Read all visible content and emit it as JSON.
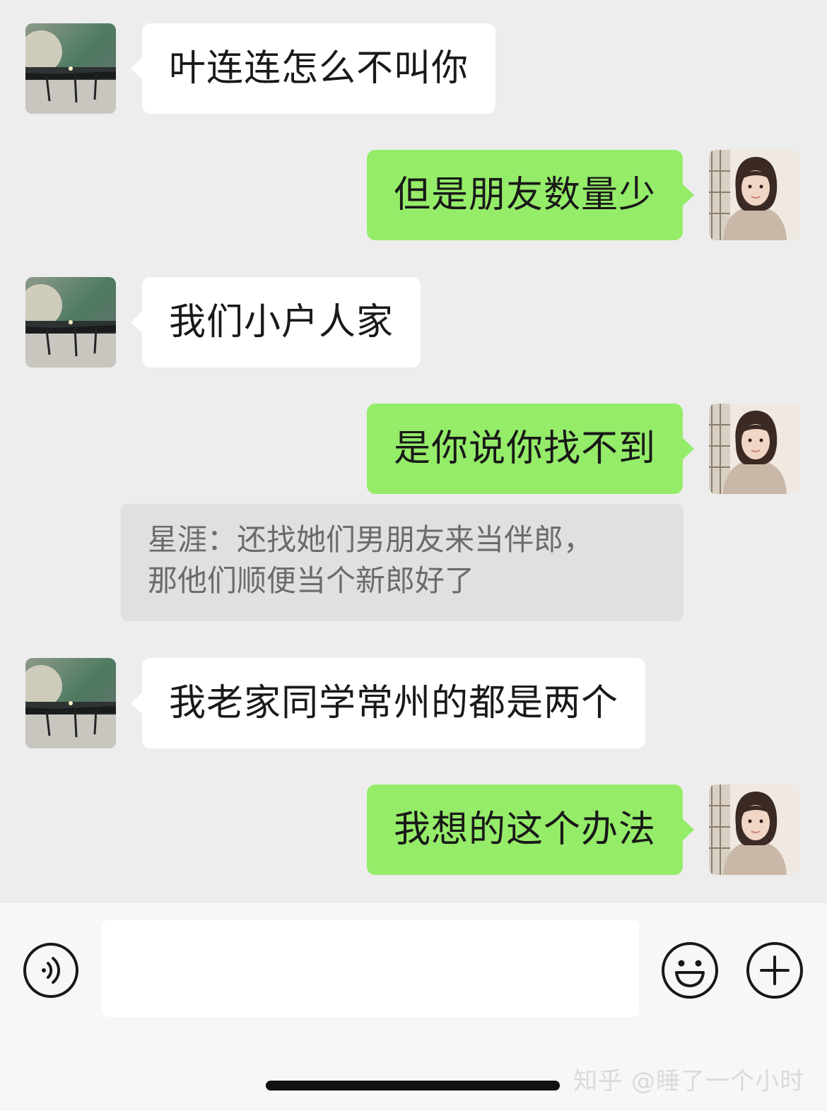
{
  "messages": [
    {
      "side": "left",
      "text": "叶连连怎么不叫你"
    },
    {
      "side": "right",
      "text": "但是朋友数量少"
    },
    {
      "side": "left",
      "text": "我们小户人家"
    },
    {
      "side": "right",
      "text": "是你说你找不到"
    },
    {
      "side": "left",
      "text": "我老家同学常州的都是两个"
    },
    {
      "side": "right",
      "text": "我想的这个办法"
    }
  ],
  "quote": {
    "line1": "星涯：还找她们男朋友来当伴郎，",
    "line2": "那他们顺便当个新郎好了"
  },
  "avatars": {
    "left": "moon-night-landscape-avatar",
    "right": "girl-in-hoodie-avatar"
  },
  "input_bar": {
    "voice_icon": "voice-icon",
    "emoji_icon": "emoji-icon",
    "plus_icon": "plus-icon",
    "placeholder": ""
  },
  "watermark": "知乎 @睡了一个小时",
  "colors": {
    "background": "#ededed",
    "sent_bubble": "#95ec69",
    "received_bubble": "#ffffff",
    "quote_bubble": "#e0e0e0"
  }
}
